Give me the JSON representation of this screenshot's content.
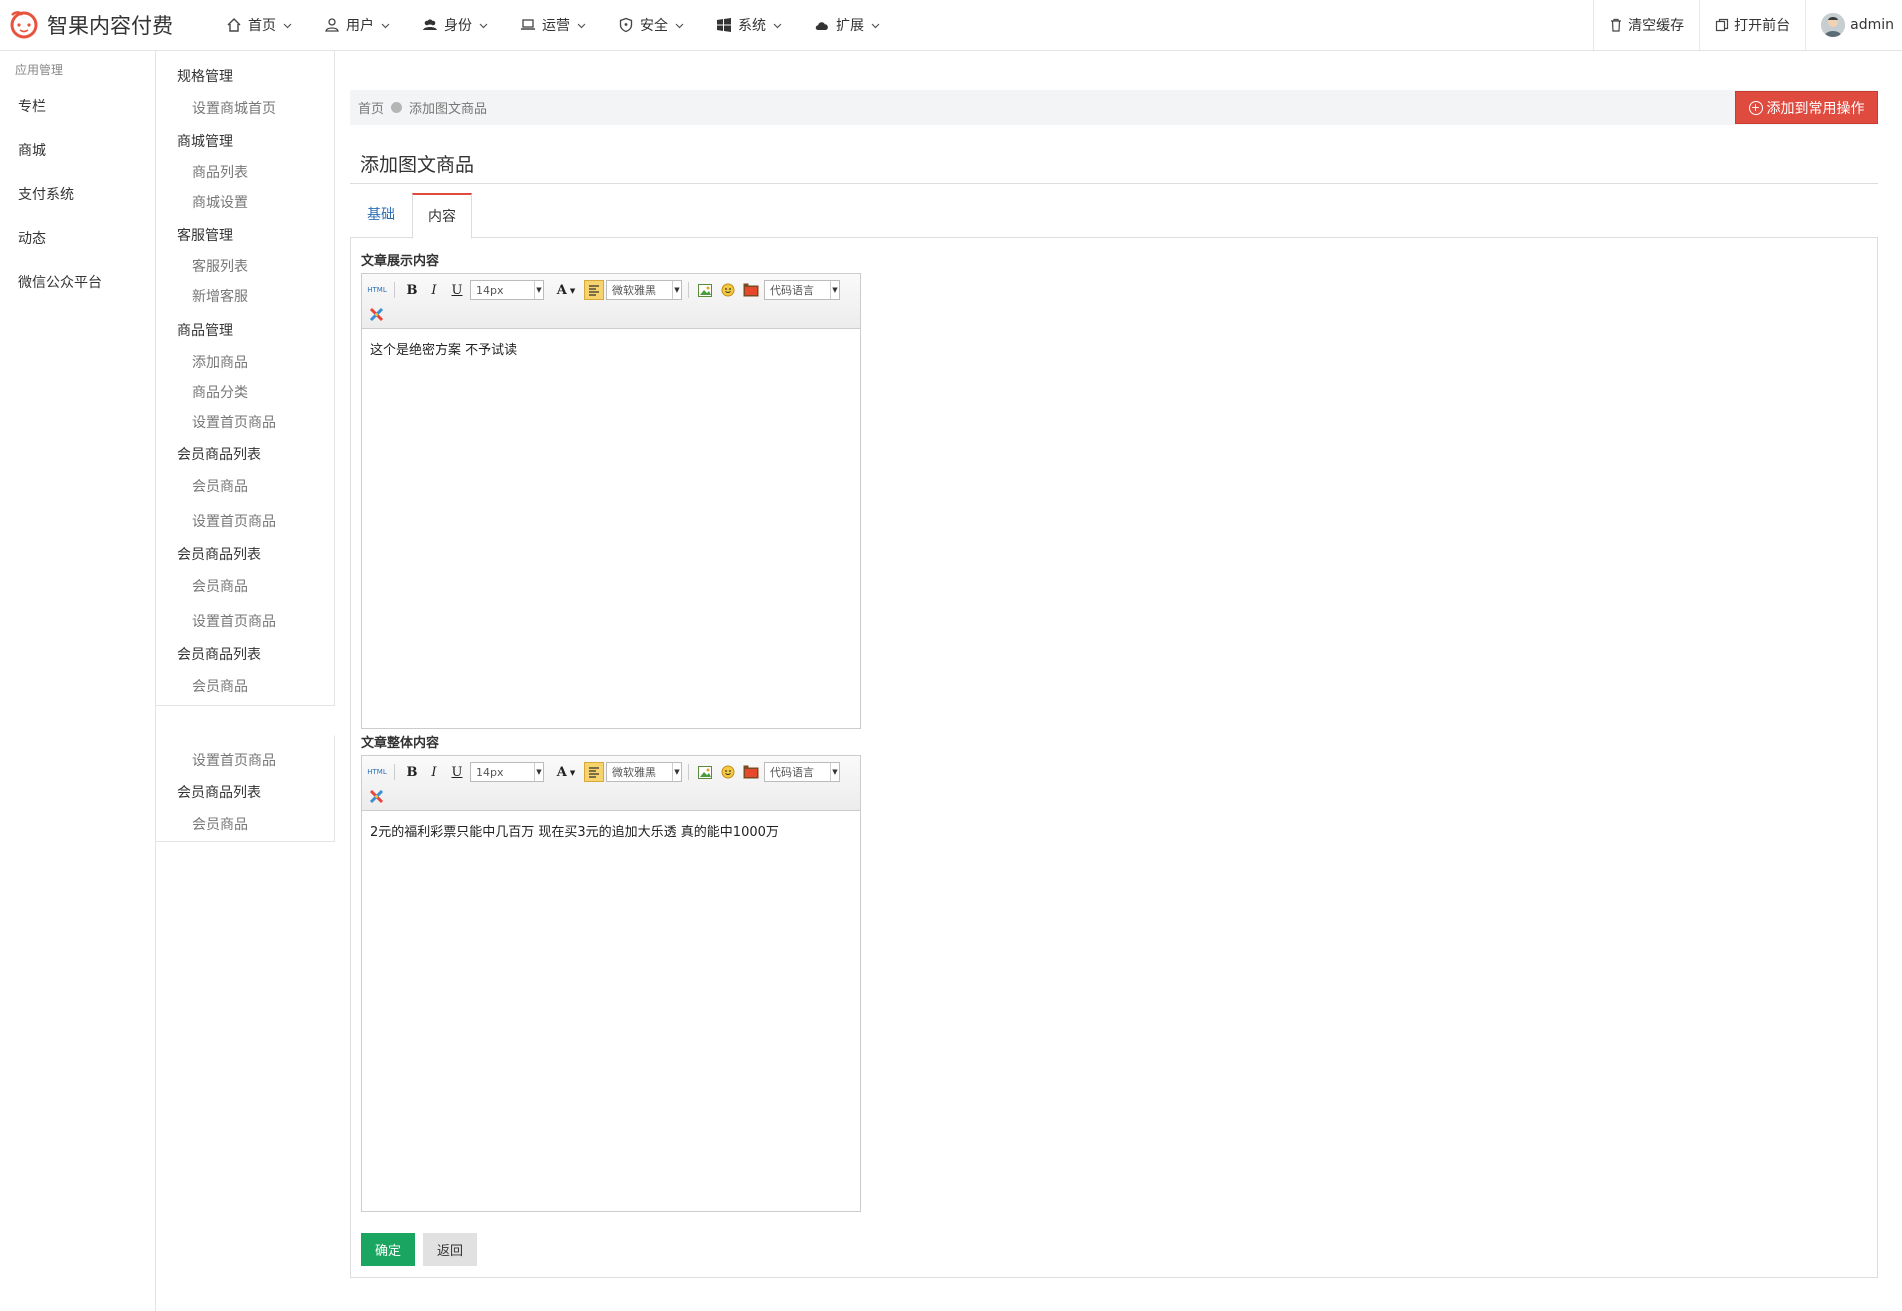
{
  "app": {
    "title": "智果内容付费"
  },
  "topnav": [
    "首页",
    "用户",
    "身份",
    "运营",
    "安全",
    "系统",
    "扩展"
  ],
  "topright": {
    "clear_cache": "清空缓存",
    "open_front": "打开前台",
    "user": "admin"
  },
  "sidebar": {
    "heading": "应用管理",
    "items": [
      "专栏",
      "商城",
      "支付系统",
      "动态",
      "微信公众平台"
    ]
  },
  "subnav": {
    "spec": "规格管理",
    "spec_home": "设置商城首页",
    "mall": "商城管理",
    "mall_list": "商品列表",
    "mall_settings": "商城设置",
    "cs": "客服管理",
    "cs_list": "客服列表",
    "cs_add": "新增客服",
    "goods": "商品管理",
    "goods_add": "添加商品",
    "goods_cat": "商品分类",
    "goods_home": "设置首页商品",
    "member1": "会员商品列表",
    "member1_goods": "会员商品",
    "member1_home": "设置首页商品",
    "member2": "会员商品列表",
    "member2_goods": "会员商品",
    "member2_home": "设置首页商品",
    "member3": "会员商品列表",
    "member3_goods": "会员商品",
    "b2_home": "设置首页商品",
    "b2_member": "会员商品列表",
    "b2_goods": "会员商品"
  },
  "breadcrumb": {
    "home": "首页",
    "current": "添加图文商品"
  },
  "add_common": "添加到常用操作",
  "page_title": "添加图文商品",
  "tabs": {
    "basic": "基础",
    "content": "内容"
  },
  "editor1": {
    "label": "文章展示内容",
    "font_size": "14px",
    "font_family": "微软雅黑",
    "code_lang": "代码语言",
    "text": "这个是绝密方案 不予试读"
  },
  "editor2": {
    "label": "文章整体内容",
    "font_size": "14px",
    "font_family": "微软雅黑",
    "code_lang": "代码语言",
    "text": "2元的福利彩票只能中几百万 现在买3元的追加大乐透 真的能中1000万"
  },
  "buttons": {
    "confirm": "确定",
    "back": "返回"
  },
  "colors": {
    "accent_red": "#e04b40",
    "confirm_green": "#1aa660",
    "tab_blue": "#2a6fb6"
  }
}
